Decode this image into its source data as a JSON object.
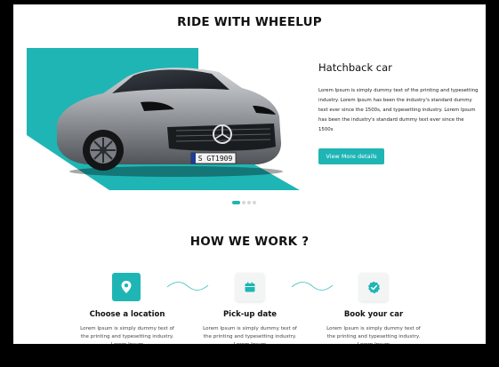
{
  "hero": {
    "heading": "RIDE WITH WHEELUP",
    "car_name": "Hatchback car",
    "description": "Lorem Ipsum is simply dummy text of the printing and typesetting industry. Lorem Ipsum has been the industry's standard dummy text ever since the 1500s, and typesetting industry. Lorem Ipsum has been the industry's standard dummy text ever since the 1500s",
    "button_label": "View More details",
    "plate": "S GT1909",
    "carousel": {
      "total": 4,
      "active_index": 0
    }
  },
  "how": {
    "heading": "HOW WE WORK ?",
    "steps": [
      {
        "title": "Choose a location",
        "text": "Lorem Ipsum is simply dummy text of the printing and typesetting industry. Lorem Ipsum",
        "icon": "location-pin-icon"
      },
      {
        "title": "Pick-up date",
        "text": "Lorem Ipsum is simply dummy text of the printing and typesetting industry. Lorem Ipsum",
        "icon": "calendar-icon"
      },
      {
        "title": "Book your car",
        "text": "Lorem Ipsum is simply dummy text of the printing and typesetting industry. Lorem Ipsum",
        "icon": "verified-badge-icon"
      }
    ]
  },
  "colors": {
    "accent": "#1fb5b5",
    "text": "#111111",
    "muted": "#444444"
  }
}
